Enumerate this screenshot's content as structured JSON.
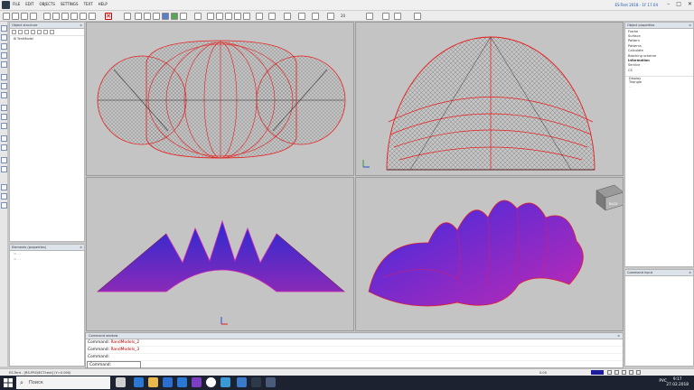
{
  "app": {
    "title": "ES-Tent 2018 - 1F 17.04",
    "menu": [
      "FILE",
      "EDIT",
      "OBJECTS",
      "SETTINGS",
      "TEXT",
      "HELP"
    ],
    "toolbar_zoom": "20"
  },
  "panels": {
    "object_structure": {
      "title": "Object structure",
      "tree": [
        "TentModel"
      ]
    },
    "elements": {
      "title": "Elements (properties)",
      "rows": [
        "▭ ...",
        "▭ ..."
      ]
    },
    "properties": {
      "title": "Object properties",
      "items": [
        "Frame",
        "Surface",
        "Pattern",
        "Patterns",
        "Calculate",
        "Batching scheme",
        "Information",
        "Service",
        "CS"
      ],
      "active_item": "Information",
      "sub_items": [
        "Display",
        "Triangle",
        "..."
      ]
    },
    "command_input": {
      "title": "Command input"
    }
  },
  "command_window": {
    "title": "Command window",
    "lines": [
      {
        "label": "Command:",
        "value": "RandModels_2"
      },
      {
        "label": "Command:",
        "value": "RandModels_3"
      },
      {
        "label": "Command:",
        "value": ""
      }
    ],
    "prompt": "Command:"
  },
  "statusbar": {
    "left": "ES-Tent - [RS-PROJECT.tent]  (Y=0.000)",
    "mid": "0.00"
  },
  "viewports": {
    "cube_label": "BACK"
  },
  "taskbar": {
    "search_placeholder": "Поиск",
    "tray_lang": "РУС",
    "time": "9:17",
    "date": "27.02.2018"
  },
  "colors": {
    "mesh_red": "#e81c1c",
    "shell_blue": "#2a2ad2",
    "shell_magenta": "#d02ab4",
    "viewport_bg": "#c4c4c4"
  }
}
